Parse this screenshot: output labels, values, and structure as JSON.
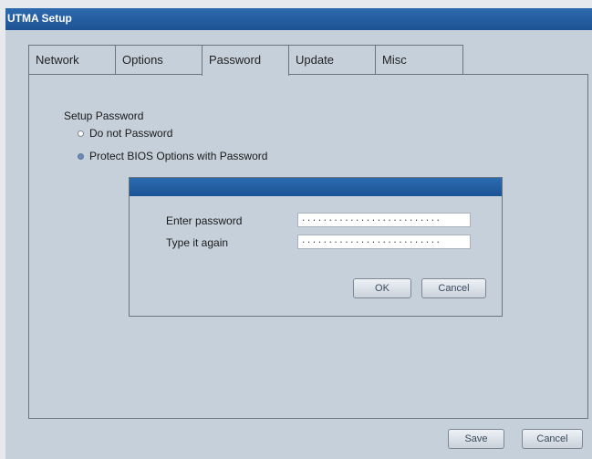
{
  "window": {
    "title": "UTMA Setup"
  },
  "tabs": [
    {
      "label": "Network"
    },
    {
      "label": "Options"
    },
    {
      "label": "Password"
    },
    {
      "label": "Update"
    },
    {
      "label": "Misc"
    }
  ],
  "active_tab": "Password",
  "password_section": {
    "label": "Setup Password",
    "options": [
      {
        "label": "Do not Password",
        "selected": false
      },
      {
        "label": "Protect BIOS Options with Password",
        "selected": true
      }
    ]
  },
  "dialog": {
    "title": "",
    "enter_label": "Enter password",
    "enter_value": "..........................",
    "again_label": "Type it again",
    "again_value": "..........................",
    "ok_label": "OK",
    "cancel_label": "Cancel"
  },
  "footer": {
    "save_label": "Save",
    "cancel_label": "Cancel"
  },
  "colors": {
    "titlebar": "#1d5393",
    "window_bg": "#c6d0da",
    "page_bg": "#e6eaef"
  }
}
